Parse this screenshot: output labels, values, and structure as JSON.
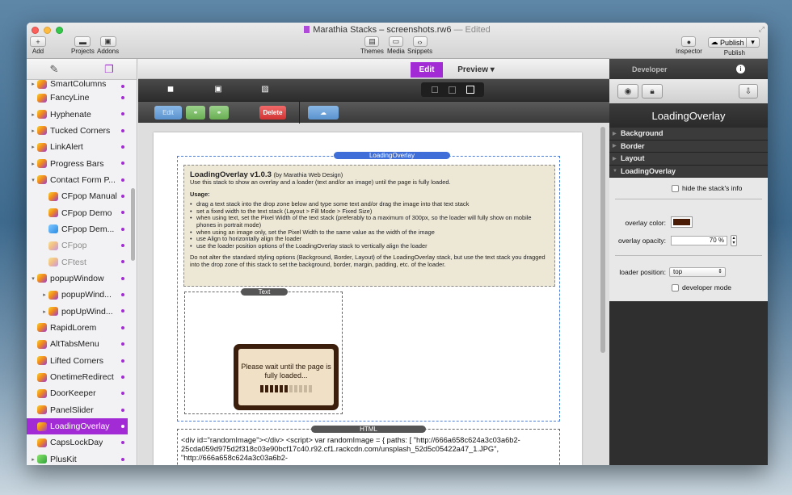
{
  "window": {
    "title": "Marathia Stacks – screenshots.rw6",
    "edited": "— Edited"
  },
  "toolbar": {
    "add_label": "Add",
    "projects_label": "Projects",
    "addons_label": "Addons",
    "themes_label": "Themes",
    "media_label": "Media",
    "snippets_label": "Snippets",
    "inspector_label": "Inspector",
    "publish_label": "Publish",
    "publish_button": "Publish"
  },
  "sidebar": {
    "items": [
      {
        "label": "SmartColumns",
        "expand": "▸",
        "indent": 0
      },
      {
        "label": "FancyLine",
        "expand": "",
        "indent": 0
      },
      {
        "label": "Hyphenate",
        "expand": "▸",
        "indent": 0
      },
      {
        "label": "Tucked Corners",
        "expand": "▸",
        "indent": 0
      },
      {
        "label": "LinkAlert",
        "expand": "▸",
        "indent": 0
      },
      {
        "label": "Progress Bars",
        "expand": "▸",
        "indent": 0
      },
      {
        "label": "Contact Form P...",
        "expand": "▾",
        "indent": 0
      },
      {
        "label": "CFpop Manual",
        "expand": "",
        "indent": 1
      },
      {
        "label": "CFpop Demo",
        "expand": "",
        "indent": 1
      },
      {
        "label": "CFpop Dem...",
        "expand": "",
        "indent": 1,
        "icon": "blue"
      },
      {
        "label": "CFpop",
        "expand": "",
        "indent": 1,
        "faded": true
      },
      {
        "label": "CFtest",
        "expand": "",
        "indent": 1,
        "faded": true
      },
      {
        "label": "popupWindow",
        "expand": "▾",
        "indent": 0
      },
      {
        "label": "popupWind...",
        "expand": "▸",
        "indent": 1
      },
      {
        "label": "popUpWind...",
        "expand": "▸",
        "indent": 1
      },
      {
        "label": "RapidLorem",
        "expand": "",
        "indent": 0
      },
      {
        "label": "AltTabsMenu",
        "expand": "",
        "indent": 0
      },
      {
        "label": "Lifted Corners",
        "expand": "",
        "indent": 0
      },
      {
        "label": "OnetimeRedirect",
        "expand": "",
        "indent": 0
      },
      {
        "label": "DoorKeeper",
        "expand": "",
        "indent": 0
      },
      {
        "label": "PanelSlider",
        "expand": "",
        "indent": 0
      },
      {
        "label": "LoadingOverlay",
        "expand": "",
        "indent": 0,
        "selected": true
      },
      {
        "label": "CapsLockDay",
        "expand": "",
        "indent": 0
      },
      {
        "label": "PlusKit",
        "expand": "▸",
        "indent": 0,
        "icon": "green"
      }
    ]
  },
  "mode": {
    "edit": "Edit",
    "preview": "Preview ▾"
  },
  "edit_toolbar": {
    "edit": "Edit",
    "delete": "Delete"
  },
  "stack": {
    "tag": "LoadingOverlay",
    "title": "LoadingOverlay v1.0.3",
    "by": "(by Marathia Web Design)",
    "intro": "Use this stack to show an overlay and a loader (text and/or an image) until the page is fully loaded.",
    "usage_title": "Usage:",
    "usage": [
      "drag a text stack into the drop zone below and type some text and/or drag the image into that text stack",
      "set a fixed width to the text stack (Layout > Fill Mode > Fixed Size)",
      "when using text, set the Pixel Width of the text stack (preferably to a maximum of 300px, so the loader will fully show on mobile phones in portrait mode)",
      "when using an image only, set the Pixel Width to the same value as the width of the image",
      "use Align to horizontally align the loader",
      "use the loader position options of the LoadingOverlay stack to vertically align the loader"
    ],
    "note": "Do not alter the standard styling options (Background, Border, Layout) of the LoadingOverlay stack, but use the text stack you dragged into the drop zone of this stack to set the background, border, margin, padding, etc. of the loader.",
    "text_tag": "Text",
    "loader_text": "Please wait until the page is fully loaded...",
    "loader_progress": 0.55,
    "html_tag": "HTML",
    "html_code": "<div id=\"randomImage\"></div> <script> var randomImage = { paths: [ \"http://666a658c624a3c03a6b2-25cda059d975d2f318c03e90bcf17c40.r92.cf1.rackcdn.com/unsplash_52d5c05422a47_1.JPG\", \"http://666a658c624a3c03a6b2-"
  },
  "inspector": {
    "tab": "Developer",
    "title": "LoadingOverlay",
    "sections": [
      "Background",
      "Border",
      "Layout",
      "LoadingOverlay"
    ],
    "hide_info": "hide the stack's info",
    "overlay_color_label": "overlay color:",
    "overlay_color": "#4a1c06",
    "overlay_opacity_label": "overlay opacity:",
    "overlay_opacity": "70 %",
    "loader_position_label": "loader position:",
    "loader_position": "top",
    "developer_mode": "developer mode"
  },
  "colors": {
    "accent": "#a32bd6"
  }
}
